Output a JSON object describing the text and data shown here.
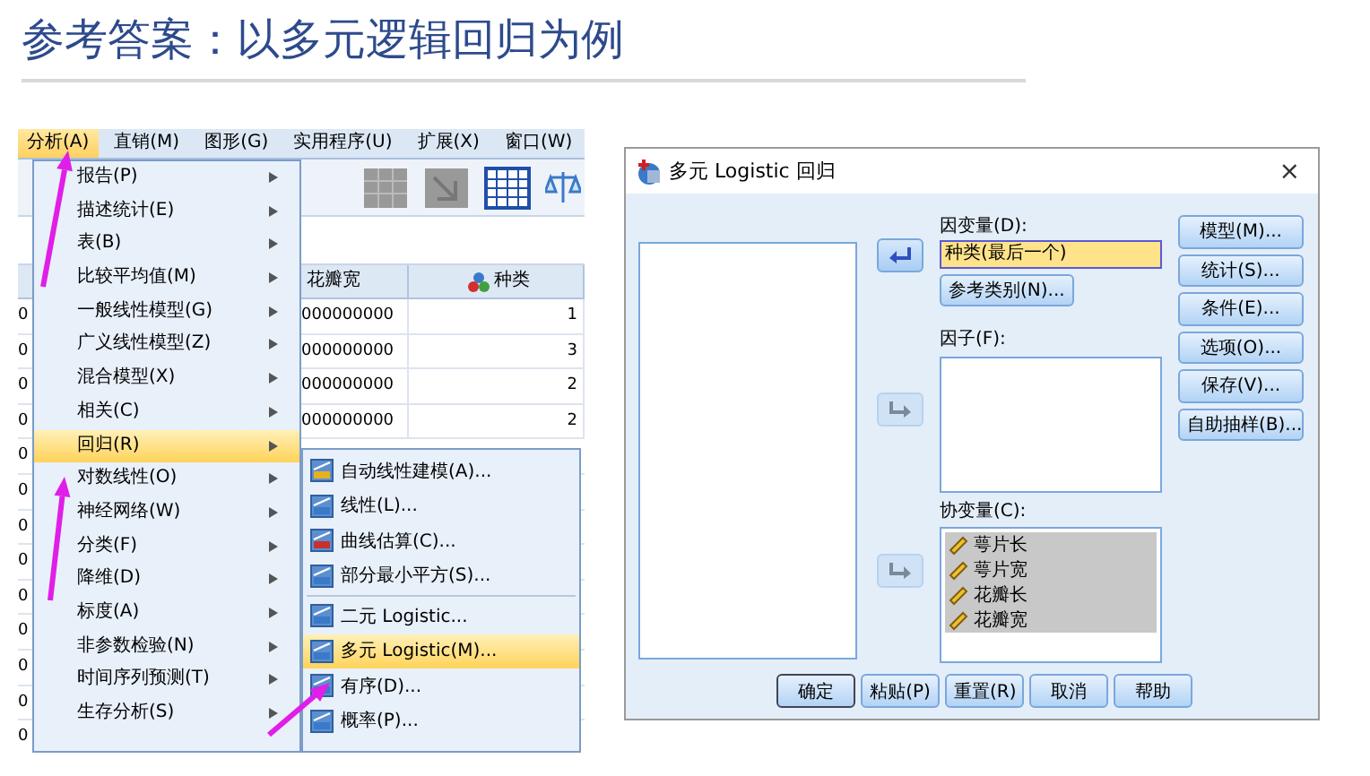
{
  "slide_title": "参考答案：以多元逻辑回归为例",
  "spss": {
    "menubar": [
      {
        "label": "分析(A)",
        "selected": true
      },
      {
        "label": "直销(M)",
        "selected": false
      },
      {
        "label": "图形(G)",
        "selected": false
      },
      {
        "label": "实用程序(U)",
        "selected": false
      },
      {
        "label": "扩展(X)",
        "selected": false
      },
      {
        "label": "窗口(W)",
        "selected": false
      }
    ],
    "columns": [
      "",
      "花瓣宽",
      "种类"
    ],
    "rows": [
      {
        "cells": [
          "0",
          "000000000",
          "1"
        ]
      },
      {
        "cells": [
          "0",
          "000000000",
          "3"
        ]
      },
      {
        "cells": [
          "0",
          "000000000",
          "2"
        ]
      },
      {
        "cells": [
          "0",
          "000000000",
          "2"
        ]
      },
      {
        "cells": [
          "0"
        ]
      },
      {
        "cells": [
          "0"
        ]
      },
      {
        "cells": [
          "0"
        ]
      },
      {
        "cells": [
          "0"
        ]
      },
      {
        "cells": [
          "0"
        ]
      },
      {
        "cells": [
          "0"
        ]
      },
      {
        "cells": [
          "0"
        ]
      },
      {
        "cells": [
          "0"
        ]
      },
      {
        "cells": [
          "0"
        ]
      }
    ],
    "menu": [
      {
        "label": "报告(P)",
        "selected": false
      },
      {
        "label": "描述统计(E)",
        "selected": false
      },
      {
        "label": "表(B)",
        "selected": false
      },
      {
        "label": "比较平均值(M)",
        "selected": false
      },
      {
        "label": "一般线性模型(G)",
        "selected": false
      },
      {
        "label": "广义线性模型(Z)",
        "selected": false
      },
      {
        "label": "混合模型(X)",
        "selected": false
      },
      {
        "label": "相关(C)",
        "selected": false
      },
      {
        "label": "回归(R)",
        "selected": true
      },
      {
        "label": "对数线性(O)",
        "selected": false
      },
      {
        "label": "神经网络(W)",
        "selected": false
      },
      {
        "label": "分类(F)",
        "selected": false
      },
      {
        "label": "降维(D)",
        "selected": false
      },
      {
        "label": "标度(A)",
        "selected": false
      },
      {
        "label": "非参数检验(N)",
        "selected": false
      },
      {
        "label": "时间序列预测(T)",
        "selected": false
      },
      {
        "label": "生存分析(S)",
        "selected": false
      }
    ],
    "submenu": [
      {
        "label": "自动线性建模(A)...",
        "selected": false,
        "separator_before": false
      },
      {
        "label": "线性(L)...",
        "selected": false,
        "separator_before": false
      },
      {
        "label": "曲线估算(C)...",
        "selected": false,
        "separator_before": false
      },
      {
        "label": "部分最小平方(S)...",
        "selected": false,
        "separator_before": false
      },
      {
        "label": "二元 Logistic...",
        "selected": false,
        "separator_before": true
      },
      {
        "label": "多元 Logistic(M)...",
        "selected": true,
        "separator_before": false
      },
      {
        "label": "有序(D)...",
        "selected": false,
        "separator_before": false
      },
      {
        "label": "概率(P)...",
        "selected": false,
        "separator_before": false
      }
    ]
  },
  "dialog": {
    "title": "多元 Logistic 回归",
    "close": "×",
    "dependent": {
      "label": "因变量(D):",
      "value": "种类(最后一个)"
    },
    "reference_button": "参考类别(N)...",
    "factors": {
      "label": "因子(F):"
    },
    "covariates": {
      "label": "协变量(C):",
      "items": [
        {
          "label": "萼片长",
          "selected": true
        },
        {
          "label": "萼片宽",
          "selected": true
        },
        {
          "label": "花瓣长",
          "selected": true
        },
        {
          "label": "花瓣宽",
          "selected": true
        }
      ]
    },
    "move_buttons": [
      {
        "disabled": false
      },
      {
        "disabled": true
      },
      {
        "disabled": true
      }
    ],
    "side_buttons": [
      "模型(M)...",
      "统计(S)...",
      "条件(E)...",
      "选项(O)...",
      "保存(V)...",
      "自助抽样(B)..."
    ],
    "bottom_buttons": [
      {
        "label": "确定",
        "default": true
      },
      {
        "label": "粘贴(P)",
        "default": false
      },
      {
        "label": "重置(R)",
        "default": false
      },
      {
        "label": "取消",
        "default": false
      },
      {
        "label": "帮助",
        "default": false
      }
    ]
  }
}
